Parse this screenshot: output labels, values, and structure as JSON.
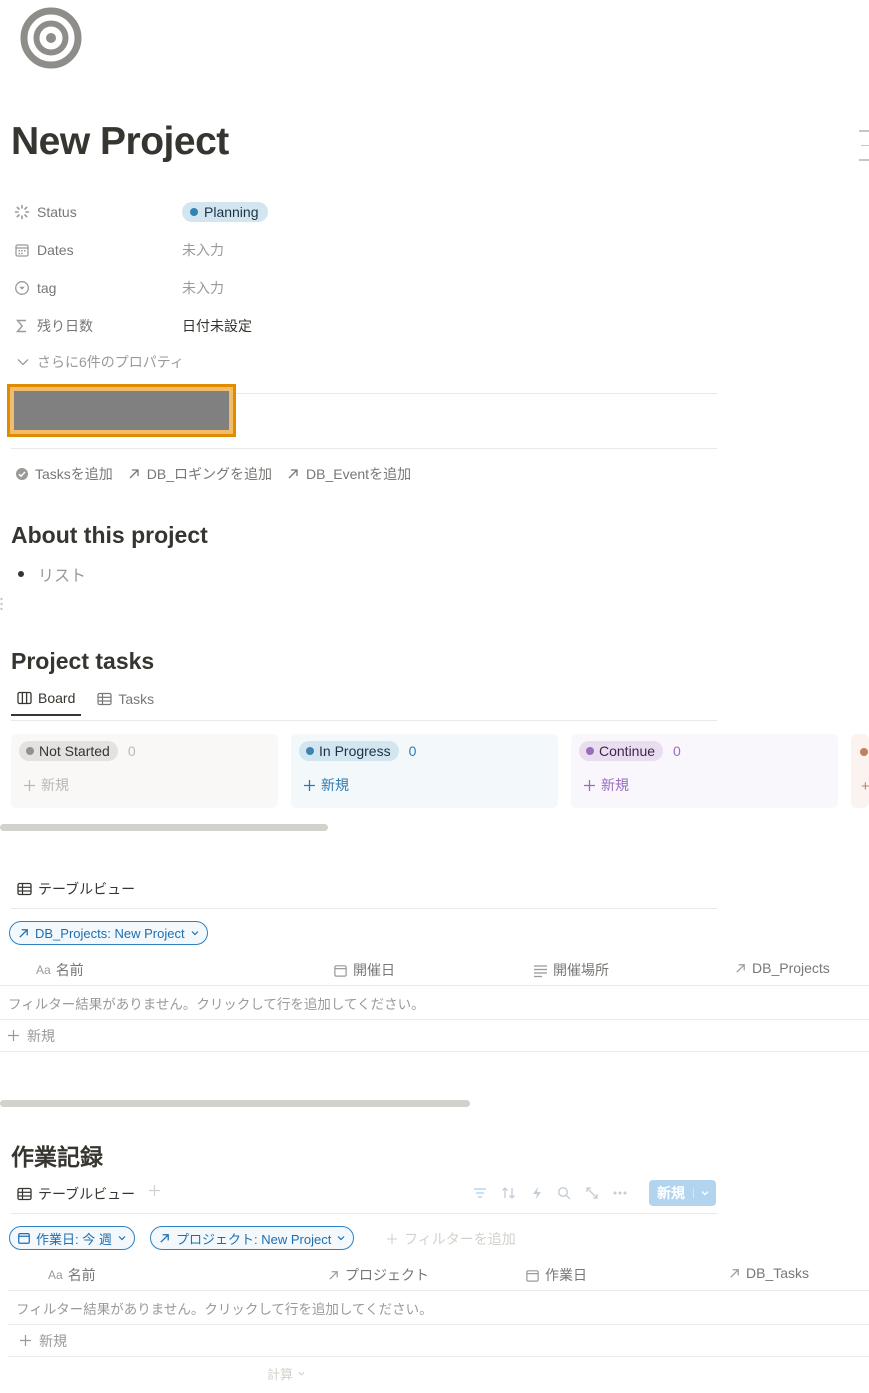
{
  "page": {
    "icon": "target-icon",
    "title": "New Project"
  },
  "properties": [
    {
      "key": "Status",
      "icon": "status-icon",
      "value": "Planning",
      "value_color": "#2f84b5"
    },
    {
      "key": "Dates",
      "icon": "calendar-icon",
      "value": "未入力"
    },
    {
      "key": "tag",
      "icon": "select-icon",
      "value": "未入力"
    },
    {
      "key": "残り日数",
      "icon": "sigma-icon",
      "value": "日付未設定"
    }
  ],
  "more_properties": "さらに6件のプロパティ",
  "relations": [
    {
      "label": "Tasksを追加",
      "icon": "check-circle-icon"
    },
    {
      "label": "DB_ロギングを追加",
      "icon": "arrow-up-right-icon"
    },
    {
      "label": "DB_Eventを追加",
      "icon": "arrow-up-right-icon"
    }
  ],
  "about": {
    "heading": "About this project",
    "list_item": "リスト"
  },
  "project_tasks": {
    "heading": "Project tasks",
    "tabs": [
      {
        "label": "Board",
        "icon": "board-icon",
        "active": true
      },
      {
        "label": "Tasks",
        "icon": "table-icon",
        "active": false
      }
    ],
    "columns": [
      {
        "label": "Not Started",
        "count": "0",
        "new": "新規",
        "bg": "#f9f8f7",
        "pill_bg": "#e3e2e0",
        "dot": "#91918e",
        "text": "#37352f",
        "accent": "#b9b8b5"
      },
      {
        "label": "In Progress",
        "count": "0",
        "new": "新規",
        "bg": "#f3f8fb",
        "pill_bg": "#d3e5ef",
        "dot": "#3d84b0",
        "text": "#183347",
        "accent": "#2f7bb0"
      },
      {
        "label": "Continue",
        "count": "0",
        "new": "新規",
        "bg": "#f9f6fc",
        "pill_bg": "#e8deee",
        "dot": "#9a6dbf",
        "text": "#412454",
        "accent": "#9a6dbf"
      }
    ]
  },
  "events_table": {
    "view_title": "テーブルビュー",
    "filter": "DB_Projects: New Project",
    "columns": [
      {
        "label": "名前",
        "icon": "title-icon"
      },
      {
        "label": "開催日",
        "icon": "calendar-icon"
      },
      {
        "label": "開催場所",
        "icon": "text-icon"
      },
      {
        "label": "DB_Projects",
        "icon": "arrow-up-right-icon"
      }
    ],
    "empty_message": "フィルター結果がありません。クリックして行を追加してください。",
    "new_label": "新規"
  },
  "work_log": {
    "heading": "作業記録",
    "view_title": "テーブルビュー",
    "new_button": "新規",
    "filters": [
      "作業日: 今 週",
      "プロジェクト: New Project"
    ],
    "add_filter": "フィルターを追加",
    "columns": [
      {
        "label": "名前",
        "icon": "title-icon"
      },
      {
        "label": "プロジェクト",
        "icon": "arrow-up-right-icon"
      },
      {
        "label": "作業日",
        "icon": "calendar-icon"
      },
      {
        "label": "DB_Tasks",
        "icon": "arrow-up-right-icon"
      }
    ],
    "empty_message": "フィルター結果がありません。クリックして行を追加してください。",
    "new_label": "新規",
    "calc_label": "計算"
  }
}
